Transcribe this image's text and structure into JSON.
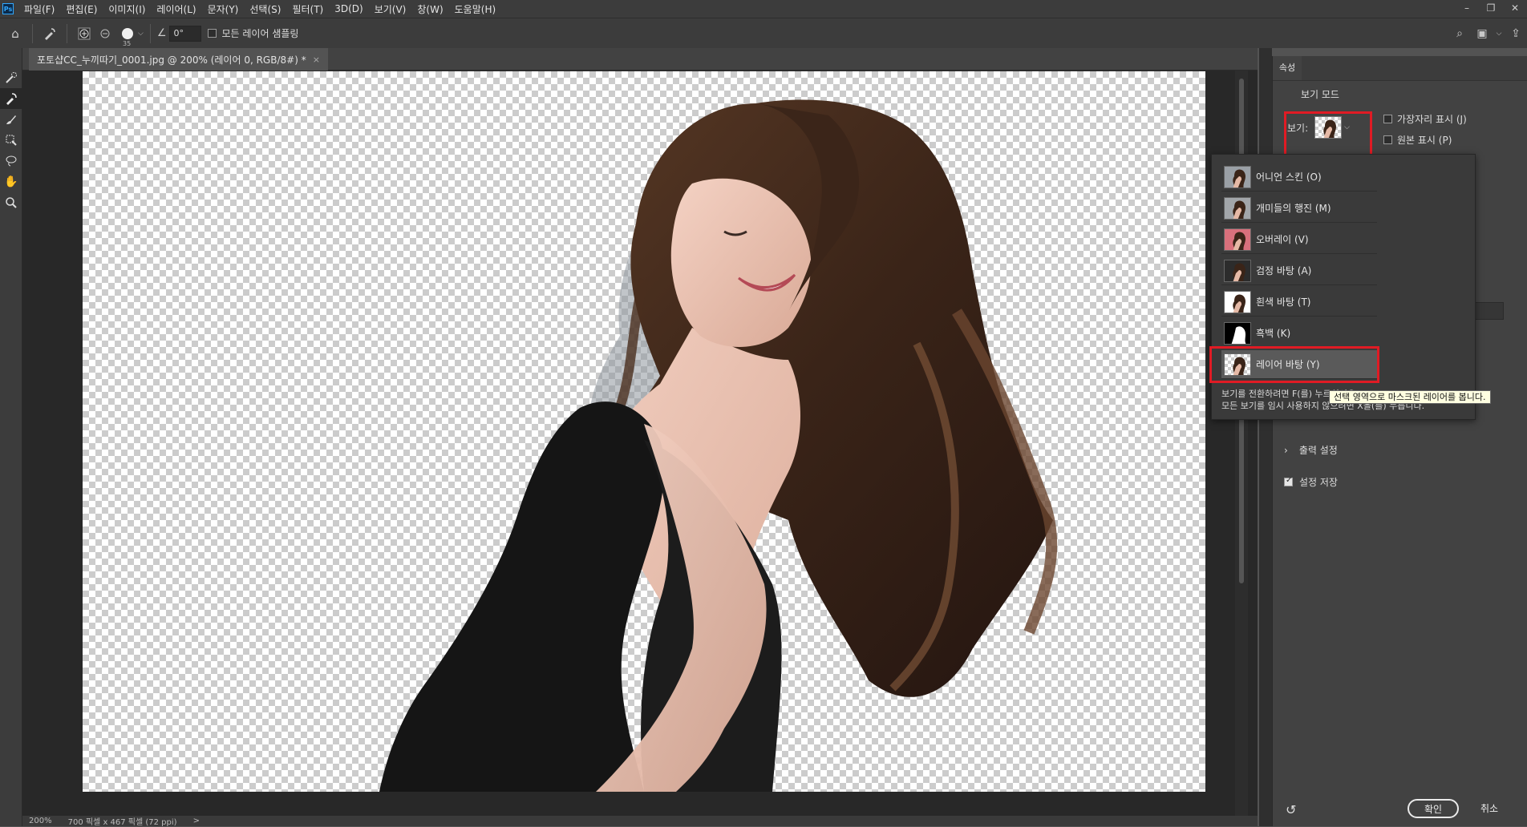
{
  "app": {
    "logo": "Ps"
  },
  "menu": [
    "파일(F)",
    "편집(E)",
    "이미지(I)",
    "레이어(L)",
    "문자(Y)",
    "선택(S)",
    "필터(T)",
    "3D(D)",
    "보기(V)",
    "창(W)",
    "도움말(H)"
  ],
  "window_controls": [
    "minimize-icon",
    "restore-icon",
    "close-icon"
  ],
  "options": {
    "brush_size": "35",
    "angle_value": "0°",
    "sample_all_layers_label": "모든 레이어 샘플링"
  },
  "document_tab": {
    "title": "포토샵CC_누끼따기_0001.jpg @ 200% (레이어 0, RGB/8#) *",
    "close": "×"
  },
  "status": {
    "zoom": "200%",
    "info": "700 픽셀 x 467 픽셀 (72 ppi)",
    "arrow": ">"
  },
  "panel": {
    "tab_label": "속성",
    "group_title": "보기 모드",
    "view_label": "보기:",
    "show_edge_label": "가장자리 표시 (J)",
    "show_original_label": "원본 표시 (P)",
    "output_label": "출력 설정",
    "save_settings_label": "설정 저장",
    "save_settings_checked": true,
    "ok_label": "확인",
    "cancel_label": "취소"
  },
  "view_modes": [
    {
      "label": "어니언 스킨 (O)",
      "style": "onion"
    },
    {
      "label": "개미들의 행진 (M)",
      "style": "ants"
    },
    {
      "label": "오버레이 (V)",
      "style": "overlay"
    },
    {
      "label": "검정 바탕 (A)",
      "style": "black"
    },
    {
      "label": "흰색 바탕 (T)",
      "style": "white"
    },
    {
      "label": "흑백 (K)",
      "style": "bw"
    },
    {
      "label": "레이어 바탕 (Y)",
      "style": "layer",
      "selected": true
    }
  ],
  "dropdown_help": {
    "line1": "보기를 전환하려면 F(를) 누르십시오.",
    "line2": "모든 보기를 임시 사용하지 않으려면 X을(를) 누릅니다."
  },
  "tooltip": "선택 영역으로 마스크된 레이어를 봅니다.",
  "colors": {
    "highlight_box": "#e01b24",
    "overlay_tint": "#d9707c"
  }
}
